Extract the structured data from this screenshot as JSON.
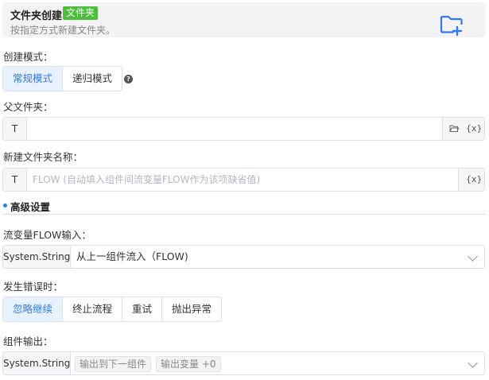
{
  "header": {
    "title": "文件夹创建",
    "badge": "文件夹",
    "description": "按指定方式新建文件夹。",
    "icon": "folder-add-icon"
  },
  "create_mode": {
    "label": "创建模式：",
    "options": [
      "常规模式",
      "递归模式"
    ],
    "selected": "常规模式",
    "help_icon": "question-circle-icon"
  },
  "parent_folder": {
    "label": "父文件夹：",
    "prefix": "T",
    "value": "",
    "folder_icon": "folder-open-icon",
    "variable_button": "{x}"
  },
  "new_folder_name": {
    "label": "新建文件夹名称：",
    "prefix": "T",
    "placeholder": "FLOW (自动填入组件间流变量FLOW作为该项缺省值)",
    "variable_button": "{x}"
  },
  "advanced": {
    "title": "高级设置"
  },
  "flow_input": {
    "label": "流变量FLOW输入：",
    "type": "System.String",
    "value": "从上一组件流入（FLOW)"
  },
  "on_error": {
    "label": "发生错误时：",
    "options": [
      "忽略继续",
      "终止流程",
      "重试",
      "抛出异常"
    ],
    "selected": "忽略继续"
  },
  "component_output": {
    "label": "组件输出：",
    "type": "System.String",
    "tags": [
      "输出到下一组件",
      "输出变量 +0"
    ]
  },
  "colors": {
    "accent": "#2f7bf5",
    "badge": "#4cbf3a"
  }
}
